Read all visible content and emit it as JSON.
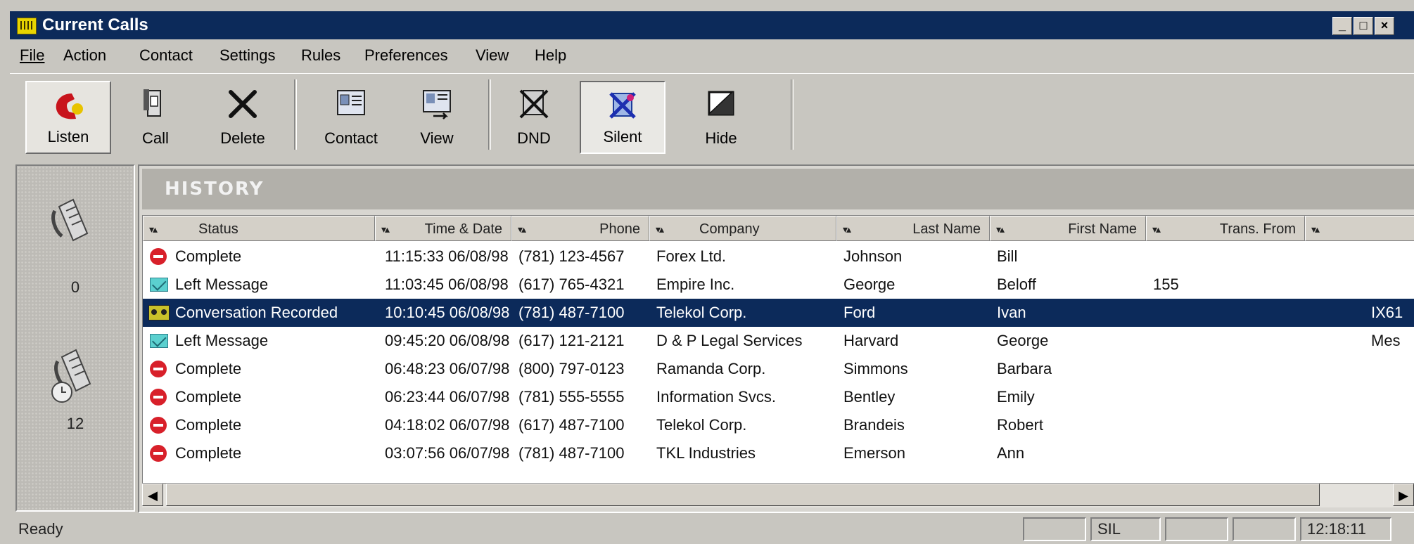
{
  "window": {
    "title": "Current Calls",
    "controls": [
      "_",
      "□",
      "×"
    ]
  },
  "menu": [
    {
      "label": "File"
    },
    {
      "label": "Action"
    },
    {
      "label": "Contact"
    },
    {
      "label": "Settings"
    },
    {
      "label": "Rules"
    },
    {
      "label": "Preferences"
    },
    {
      "label": "View"
    },
    {
      "label": "Help"
    }
  ],
  "toolbar": {
    "listen": "Listen",
    "call": "Call",
    "delete": "Delete",
    "contact": "Contact",
    "view": "View",
    "dnd": "DND",
    "silent": "Silent",
    "hide": "Hide"
  },
  "left_panel": {
    "current_count": "0",
    "history_count": "12"
  },
  "history": {
    "title": "HISTORY",
    "columns": [
      "Status",
      "Time & Date",
      "Phone",
      "Company",
      "Last Name",
      "First Name",
      "Trans. From",
      ""
    ],
    "sort_glyph": "▾▴",
    "rows": [
      {
        "icon": "complete",
        "status": "Complete",
        "time": "11:15:33 06/08/98",
        "phone": "(781) 123-4567",
        "company": "Forex Ltd.",
        "last": "Johnson",
        "first": "Bill",
        "trans": "",
        "extra": ""
      },
      {
        "icon": "mail",
        "status": "Left Message",
        "time": "11:03:45 06/08/98",
        "phone": "(617) 765-4321",
        "company": "Empire Inc.",
        "last": "George",
        "first": "Beloff",
        "trans": "155",
        "extra": ""
      },
      {
        "icon": "rec",
        "status": "Conversation Recorded",
        "time": "10:10:45 06/08/98",
        "phone": "(781) 487-7100",
        "company": "Telekol Corp.",
        "last": "Ford",
        "first": "Ivan",
        "trans": "",
        "extra": "IX61"
      },
      {
        "icon": "mail",
        "status": "Left Message",
        "time": "09:45:20 06/08/98",
        "phone": "(617) 121-2121",
        "company": "D & P Legal Services",
        "last": "Harvard",
        "first": "George",
        "trans": "",
        "extra": "Mes"
      },
      {
        "icon": "complete",
        "status": "Complete",
        "time": "06:48:23 06/07/98",
        "phone": "(800) 797-0123",
        "company": "Ramanda Corp.",
        "last": "Simmons",
        "first": "Barbara",
        "trans": "",
        "extra": ""
      },
      {
        "icon": "complete",
        "status": "Complete",
        "time": "06:23:44 06/07/98",
        "phone": "(781) 555-5555",
        "company": "Information Svcs.",
        "last": "Bentley",
        "first": "Emily",
        "trans": "",
        "extra": ""
      },
      {
        "icon": "complete",
        "status": "Complete",
        "time": "04:18:02 06/07/98",
        "phone": "(617) 487-7100",
        "company": "Telekol Corp.",
        "last": "Brandeis",
        "first": "Robert",
        "trans": "",
        "extra": ""
      },
      {
        "icon": "complete",
        "status": "Complete",
        "time": "03:07:56 06/07/98",
        "phone": "(781) 487-7100",
        "company": "TKL Industries",
        "last": "Emerson",
        "first": "Ann",
        "trans": "",
        "extra": ""
      }
    ],
    "selected_row": 2
  },
  "statusbar": {
    "text": "Ready",
    "mode": "SIL",
    "clock": "12:18:11"
  },
  "colors": {
    "titlebar": "#0c2a5a",
    "selection": "#0c2a5a",
    "face": "#d4d0c8"
  }
}
